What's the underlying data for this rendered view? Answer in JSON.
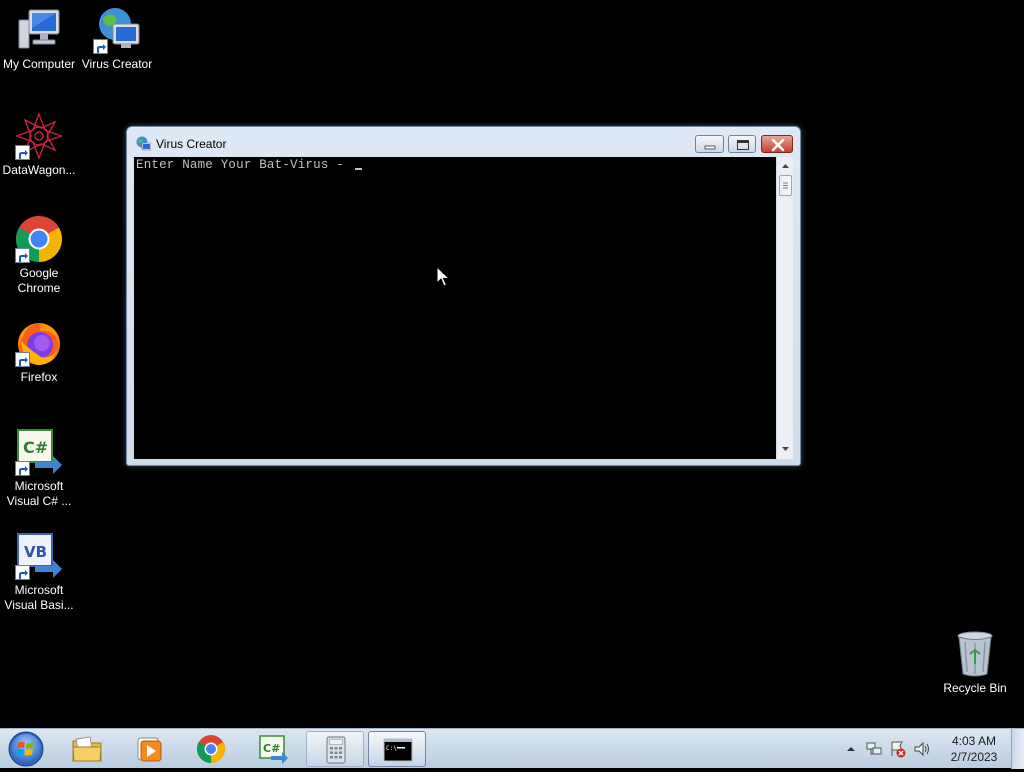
{
  "desktop": {
    "icons": [
      {
        "label": "My Computer"
      },
      {
        "label": "Virus Creator"
      },
      {
        "label": "DataWagon..."
      },
      {
        "label": "Google Chrome"
      },
      {
        "label": "Firefox"
      },
      {
        "label": "Microsoft Visual C# ..."
      },
      {
        "label": "Microsoft Visual Basi..."
      }
    ],
    "recycle_bin": {
      "label": "Recycle Bin"
    }
  },
  "window": {
    "title": "Virus Creator",
    "icon": "globe-computer-icon",
    "console_text": "Enter Name Your Bat-Virus - ",
    "buttons": {
      "minimize": "minimize-icon",
      "maximize": "maximize-icon",
      "close": "close-icon"
    }
  },
  "taskbar": {
    "items": [
      {
        "name": "windows-explorer",
        "icon": "folder-icon",
        "state": "pinned"
      },
      {
        "name": "media-player",
        "icon": "media-player-icon",
        "state": "pinned"
      },
      {
        "name": "google-chrome",
        "icon": "chrome-icon",
        "state": "pinned"
      },
      {
        "name": "visual-csharp",
        "icon": "csharp-icon",
        "state": "pinned"
      },
      {
        "name": "calculator",
        "icon": "calculator-icon",
        "state": "open"
      },
      {
        "name": "command-prompt",
        "icon": "cmd-icon",
        "state": "active"
      }
    ],
    "clock": {
      "time": "4:03 AM",
      "date": "2/7/2023"
    }
  },
  "colors": {
    "desktop_bg": "#000000",
    "console_bg": "#000000",
    "console_text": "#c0c0c0",
    "window_frame": "#dfe9f5",
    "close_button": "#c6412a"
  }
}
